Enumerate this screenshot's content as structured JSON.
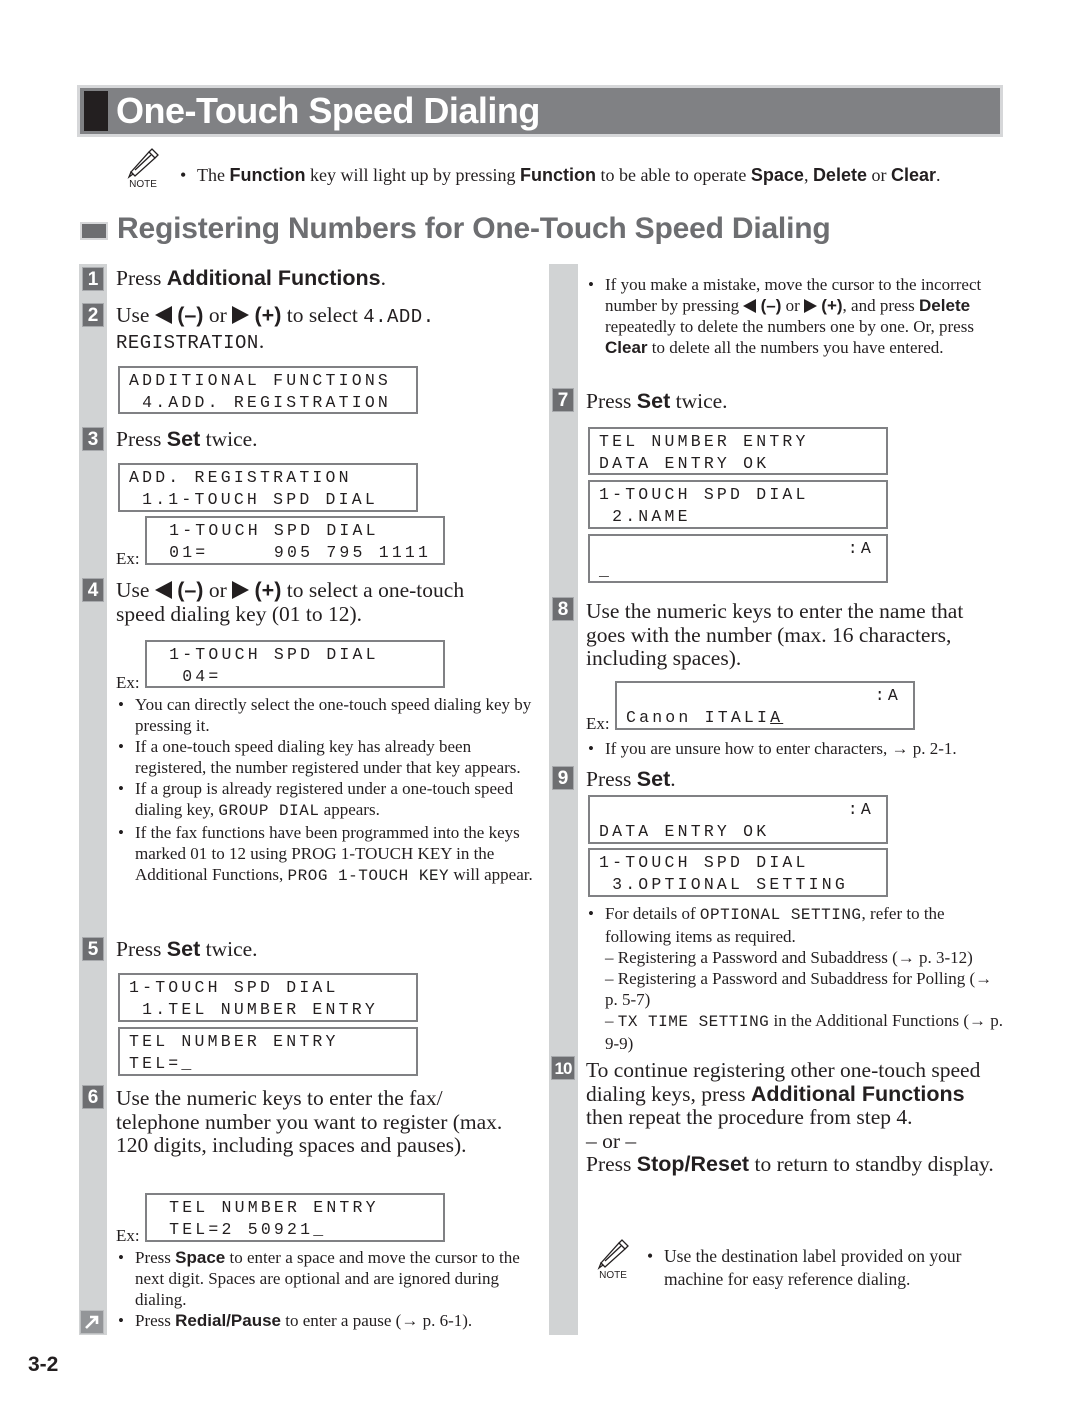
{
  "title": "One-Touch Speed Dialing",
  "note_label": "NOTE",
  "top_note": {
    "p1": "The ",
    "b1": "Function",
    "p2": " key will light up by pressing ",
    "b2": "Function",
    "p3": " to be able to operate ",
    "b3": "Space",
    "p4": ", ",
    "b4": "Delete",
    "p5": " or ",
    "b5": "Clear",
    "p6": "."
  },
  "section_heading": "Registering Numbers for One-Touch Speed Dialing",
  "ex_label": "Ex:",
  "arrow_minus": "(–)",
  "arrow_plus": "(+)",
  "or_word": " or ",
  "steps": {
    "s1": {
      "num": "1",
      "p1": "Press ",
      "b1": "Additional Functions",
      "p2": "."
    },
    "s2": {
      "num": "2",
      "p1": "Use ",
      "p2": " to select ",
      "m1": "4.ADD.",
      "m2": "REGISTRATION",
      "p3": ".",
      "lcd": [
        "ADDITIONAL FUNCTIONS",
        " 4.ADD. REGISTRATION"
      ]
    },
    "s3": {
      "num": "3",
      "p1": "Press ",
      "b1": "Set",
      "p2": " twice.",
      "lcd": [
        "ADD. REGISTRATION",
        " 1.1-TOUCH SPD DIAL"
      ],
      "ex_lcd": [
        " 1-TOUCH SPD DIAL",
        " 01=     905 795 1111"
      ]
    },
    "s4": {
      "num": "4",
      "p1": "Use ",
      "p2": " to select a one-touch",
      "line2": "speed dialing key (01 to 12).",
      "ex_lcd": [
        " 1-TOUCH SPD DIAL",
        "  04="
      ],
      "bullets": {
        "b1": "You can directly select the one-touch speed dialing key by pressing it.",
        "b2": "If a one-touch speed dialing key has already been registered, the number registered under that key appears.",
        "b3a": "If a group is already registered under a one-touch speed dialing key, ",
        "b3m": "GROUP DIAL",
        "b3b": " appears.",
        "b4a": "If the fax functions have been programmed into the keys marked 01 to 12 using PROG 1-TOUCH KEY in the Additional Functions, ",
        "b4m": "PROG 1-TOUCH KEY",
        "b4b": " will appear."
      }
    },
    "s5": {
      "num": "5",
      "p1": "Press ",
      "b1": "Set",
      "p2": " twice.",
      "lcd1": [
        "1-TOUCH SPD DIAL",
        " 1.TEL NUMBER ENTRY"
      ],
      "lcd2": [
        "TEL NUMBER ENTRY",
        "TEL=_"
      ]
    },
    "s6": {
      "num": "6",
      "text": "Use the numeric keys to enter the fax/ telephone number you want to register (max. 120 digits, including spaces and pauses).",
      "ex_lcd": [
        " TEL NUMBER ENTRY",
        " TEL=2 50921_"
      ],
      "bullets": {
        "b1a": "Press ",
        "b1b": "Space",
        "b1c": " to enter a space and move the cursor to the next digit. Spaces are optional and are ignored during dialing.",
        "b2a": "Press ",
        "b2b": "Redial/Pause",
        "b2c": " to enter a pause (→ p. 6-1).",
        "b3a": "If you make a mistake, move the cursor to the incorrect number by pressing ",
        "b3b": ", and press ",
        "b3c": "Delete",
        "b3d": " repeatedly to delete the numbers one by one. Or, press ",
        "b3e": "Clear",
        "b3f": " to delete all the numbers you have entered."
      }
    },
    "s7": {
      "num": "7",
      "p1": "Press ",
      "b1": "Set",
      "p2": " twice.",
      "lcd1": [
        "TEL NUMBER ENTRY",
        "DATA ENTRY OK"
      ],
      "lcd2": [
        "1-TOUCH SPD DIAL",
        " 2.NAME"
      ],
      "lcd3_right": ":A",
      "lcd3_line2": "_"
    },
    "s8": {
      "num": "8",
      "text": "Use the numeric keys to enter the name that goes with the number (max. 16 characters, including spaces).",
      "ex_right": ":A",
      "ex_line2a": "Canon ITALI",
      "ex_line2b": "A",
      "bullet": "If you are unsure how to enter characters, → p. 2-1."
    },
    "s9": {
      "num": "9",
      "p1": "Press ",
      "b1": "Set",
      "p2": ".",
      "lcd1_right": ":A",
      "lcd1_line2": "DATA ENTRY OK",
      "lcd2": [
        "1-TOUCH SPD DIAL",
        " 3.OPTIONAL SETTING"
      ],
      "bullet_a": "For details of ",
      "bullet_m": "OPTIONAL SETTING",
      "bullet_b": ", refer to the following items as required.",
      "dash1": "– Registering a Password and Subaddress (→ p. 3-12)",
      "dash2": "– Registering a Password and Subaddress for Polling (→ p. 5-7)",
      "dash3a": "– ",
      "dash3m": "TX TIME SETTING",
      "dash3b": " in the Additional Functions (→ p. 9-9)"
    },
    "s10": {
      "num": "10",
      "p1": "To continue registering other one-touch speed dialing keys, press ",
      "b1": "Additional Functions",
      "p2": " then repeat the procedure from step 4.",
      "or": "– or –",
      "p3": "Press ",
      "b2": "Stop/Reset",
      "p4": " to return to standby display.",
      "note": "Use the destination label provided on your machine for easy reference dialing."
    }
  },
  "page_number": "3-2"
}
